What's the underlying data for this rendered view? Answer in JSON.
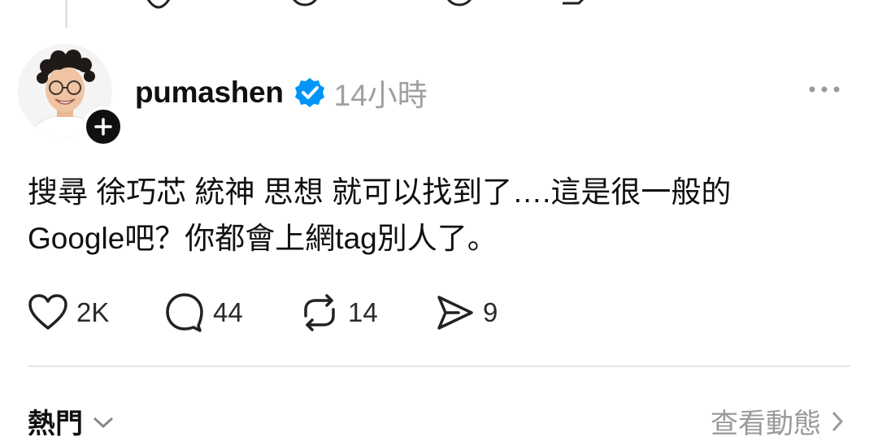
{
  "post": {
    "username": "pumashen",
    "time": "14小時",
    "content_line1": "搜尋 徐巧芯 統神 思想 就可以找到了….這是很一般的",
    "content_line2": "Google吧？你都會上網tag別人了。",
    "verified_icon": "verified-badge-icon",
    "verified_color": "#0095f6"
  },
  "actions": {
    "likes": "2K",
    "comments": "44",
    "reposts": "14",
    "shares": "9"
  },
  "footer": {
    "left_label": "熱門",
    "right_label": "查看動態"
  }
}
